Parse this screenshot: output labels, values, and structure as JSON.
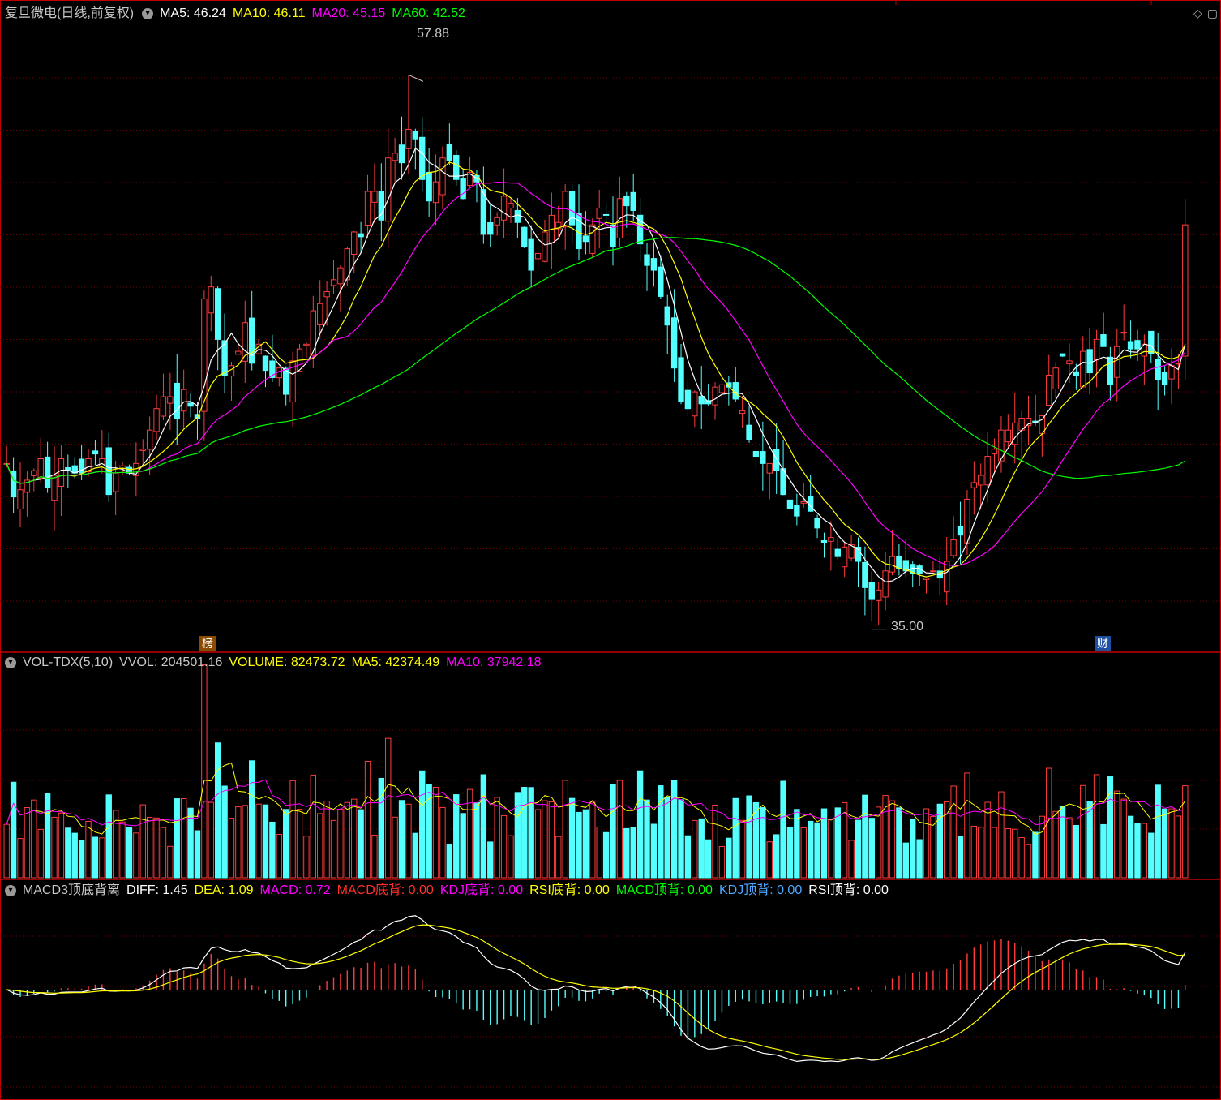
{
  "header": {
    "title": "复旦微电(日线,前复权)",
    "ma5": "MA5: 46.24",
    "ma10": "MA10: 46.11",
    "ma20": "MA20: 45.15",
    "ma60": "MA60: 42.52"
  },
  "annotations": {
    "high": "57.88",
    "low": "35.00",
    "badge_bang": "榜",
    "badge_cai": "财"
  },
  "vol": {
    "name": "VOL-TDX(5,10)",
    "vvol": "VVOL: 204501.16",
    "volume": "VOLUME: 82473.72",
    "ma5": "MA5: 42374.49",
    "ma10": "MA10: 37942.18"
  },
  "macd": {
    "name": "MACD3顶底背离",
    "diff": "DIFF: 1.45",
    "dea": "DEA: 1.09",
    "macd": "MACD: 0.72",
    "macd_bottom": "MACD底背: 0.00",
    "kdj_bottom": "KDJ底背: 0.00",
    "rsi_bottom": "RSI底背: 0.00",
    "macd_top": "MACD顶背: 0.00",
    "kdj_top": "KDJ顶背: 0.00",
    "rsi_top": "RSI顶背: 0.00"
  },
  "colors": {
    "up": "#ff3d3d",
    "down": "#54ffff",
    "ma5": "#ffffff",
    "ma10": "#ffff00",
    "ma20": "#ff00ff",
    "ma60": "#00ff00",
    "grid": "#7a0000",
    "border": "#c00000"
  },
  "chart_data": {
    "type": "candlestick",
    "price_range": [
      34,
      60
    ],
    "high": 57.88,
    "low": 35.0,
    "closes": [
      41.6,
      40.2,
      40.5,
      40.9,
      41.3,
      41.8,
      40.6,
      41.1,
      41.8,
      41.3,
      41.2,
      41.2,
      41.8,
      42.0,
      41.8,
      40.3,
      41.2,
      41.5,
      41.2,
      41.6,
      42.2,
      43.0,
      43.9,
      44.4,
      44.4,
      43.5,
      44.7,
      44.0,
      43.5,
      48.5,
      49.0,
      46.8,
      45.3,
      45.7,
      46.3,
      47.5,
      45.8,
      46.6,
      45.5,
      45.2,
      45.6,
      44.5,
      45.9,
      46.4,
      46.6,
      48.0,
      48.3,
      48.8,
      49.3,
      49.8,
      50.6,
      51.3,
      51.1,
      53.0,
      53.0,
      51.8,
      54.4,
      54.6,
      54.2,
      55.6,
      55.2,
      53.5,
      52.6,
      53.4,
      54.4,
      54.3,
      53.5,
      52.7,
      53.8,
      53.4,
      51.2,
      51.2,
      51.9,
      52.8,
      52.5,
      51.7,
      50.7,
      49.7,
      50.4,
      51.3,
      52.0,
      51.7,
      53.0,
      51.6,
      50.6,
      50.9,
      51.6,
      52.3,
      52.0,
      50.7,
      52.7,
      52.4,
      52.2,
      50.8,
      49.9,
      49.7,
      48.6,
      47.4,
      45.6,
      44.2,
      43.9,
      44.6,
      44.1,
      44.1,
      44.8,
      44.9,
      44.8,
      44.3,
      43.8,
      42.6,
      41.9,
      41.6,
      41.6,
      41.3,
      40.3,
      39.7,
      39.4,
      40.0,
      39.6,
      38.9,
      38.3,
      38.5,
      37.7,
      38.1,
      38.2,
      37.5,
      36.4,
      35.9,
      36.3,
      37.1,
      37.7,
      37.2,
      37.1,
      37.0,
      37.0,
      36.8,
      37.1,
      36.8,
      37.5,
      38.4,
      38.6,
      40.1,
      40.8,
      41.1,
      41.9,
      42.2,
      43.0,
      43.0,
      43.3,
      43.5,
      43.5,
      43.3,
      43.6,
      45.3,
      45.6,
      46.1,
      45.9,
      45.3,
      46.3,
      45.4,
      46.8,
      46.5,
      44.9,
      46.5,
      47.1,
      46.4,
      46.4,
      46.6,
      46.2,
      45.1,
      44.9,
      45.7,
      45.8,
      51.6
    ],
    "volume_max": 220000,
    "macd_range": [
      -3.6,
      3.0
    ],
    "diff_last": 1.45,
    "dea_last": 1.09,
    "macd_last": 0.72
  }
}
